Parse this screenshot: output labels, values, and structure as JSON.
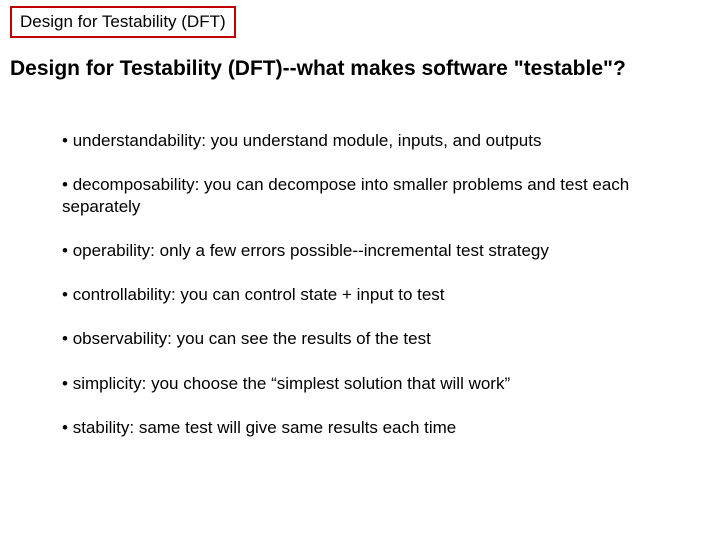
{
  "title_box": "Design for Testability (DFT)",
  "heading": "Design for Testability (DFT)--what makes software \"testable\"?",
  "bullets": [
    "understandability:  you understand module, inputs, and outputs",
    "decomposability:  you can decompose into smaller problems and test each separately",
    "operability:  only a few errors possible--incremental test strategy",
    "controllability:  you can control state + input to test",
    "observability:  you can see the results of the test",
    "simplicity:  you choose the “simplest solution that will work”",
    "stability:  same test will give same results each time"
  ]
}
